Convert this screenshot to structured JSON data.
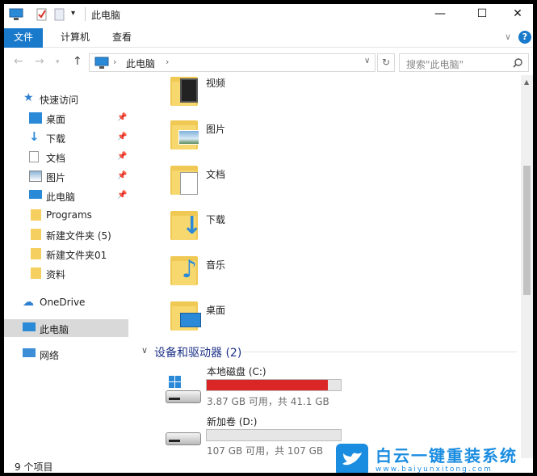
{
  "window": {
    "title": "此电脑",
    "minimize": "—",
    "maximize": "☐",
    "close": "✕"
  },
  "ribbon": {
    "tabs": [
      "文件",
      "计算机",
      "查看"
    ],
    "collapse": "∨",
    "help": "?"
  },
  "address": {
    "path": "此电脑",
    "search_placeholder": "搜索\"此电脑\""
  },
  "sidebar": {
    "quick_access": "快速访问",
    "items": [
      "桌面",
      "下载",
      "文档",
      "图片",
      "此电脑",
      "Programs",
      "新建文件夹 (5)",
      "新建文件夹01",
      "资料"
    ],
    "onedrive": "OneDrive",
    "this_pc": "此电脑",
    "network": "网络"
  },
  "folders": [
    "视频",
    "图片",
    "文档",
    "下载",
    "音乐",
    "桌面"
  ],
  "devices": {
    "heading": "设备和驱动器 (2)",
    "drives": [
      {
        "name": "本地磁盘 (C:)",
        "info": "3.87 GB 可用，共 41.1 GB",
        "used_fraction": 0.906
      },
      {
        "name": "新加卷 (D:)",
        "info": "107 GB 可用，共 107 GB",
        "used_fraction": 0.0
      }
    ]
  },
  "status": {
    "count": "9 个项目"
  },
  "watermark": {
    "text": "白云一键重装系统",
    "url": "www.baiyunxitong.com"
  }
}
